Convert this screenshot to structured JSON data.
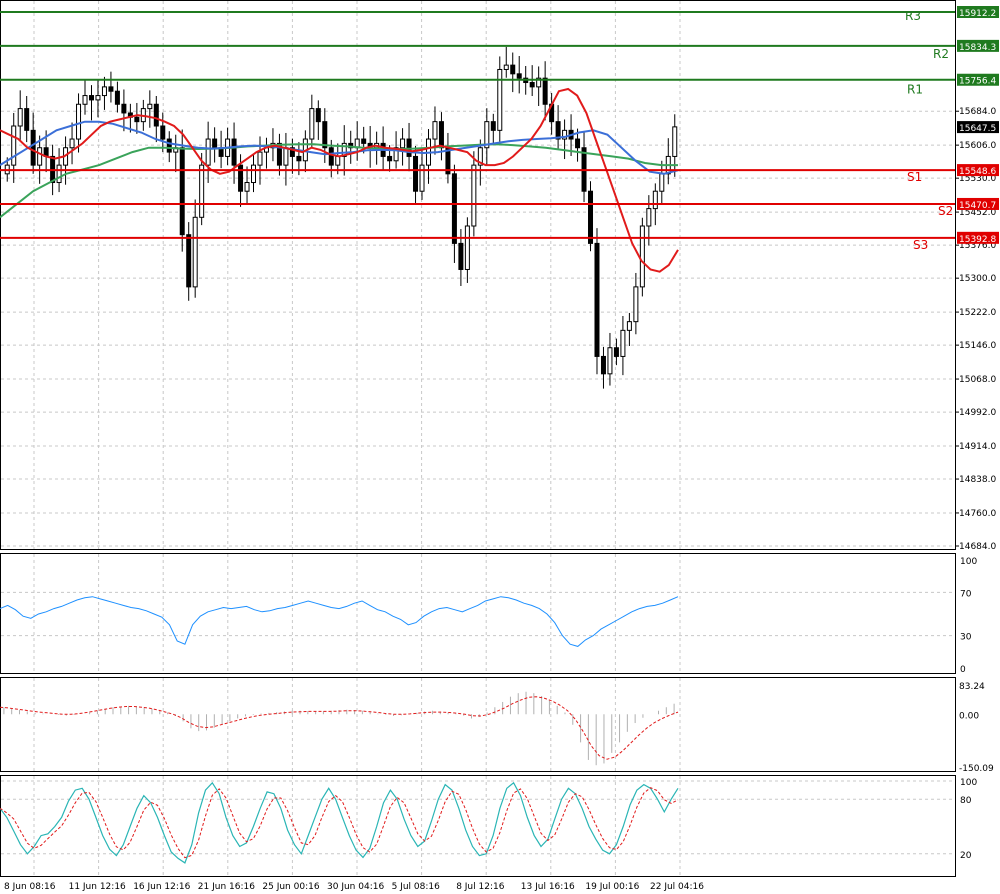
{
  "chart_data": [
    {
      "type": "candlestick",
      "y_ticks": [
        "15684.0",
        "15606.0",
        "15530.0",
        "15452.0",
        "15376.0",
        "15300.0",
        "15222.0",
        "15146.0",
        "15068.0",
        "14992.0",
        "14914.0",
        "14838.0",
        "14760.0",
        "14684.0"
      ],
      "ylim": [
        14684,
        15930
      ],
      "x_tick_labels": [
        "8 Jun 08:16",
        "11 Jun 12:16",
        "16 Jun 12:16",
        "21 Jun 16:16",
        "25 Jun 00:16",
        "30 Jun 04:16",
        "5 Jul 08:16",
        "8 Jul 12:16",
        "13 Jul 16:16",
        "19 Jul 00:16",
        "22 Jul 04:16"
      ],
      "current_price": "15647.5",
      "levels": [
        {
          "name": "R3",
          "value": 15912.2,
          "label": "15912.2",
          "color": "#1f7a1f"
        },
        {
          "name": "R2",
          "value": 15834.3,
          "label": "15834.3",
          "color": "#1f7a1f"
        },
        {
          "name": "R1",
          "value": 15756.4,
          "label": "15756.4",
          "color": "#1f7a1f"
        },
        {
          "name": "S1",
          "value": 15548.6,
          "label": "15548.6",
          "color": "#e00000"
        },
        {
          "name": "S2",
          "value": 15470.7,
          "label": "15470.7",
          "color": "#e00000"
        },
        {
          "name": "S3",
          "value": 15392.8,
          "label": "15392.8",
          "color": "#e00000"
        }
      ],
      "close_series": [
        15560,
        15650,
        15690,
        15640,
        15560,
        15600,
        15580,
        15520,
        15560,
        15600,
        15620,
        15700,
        15720,
        15710,
        15720,
        15740,
        15730,
        15700,
        15680,
        15670,
        15660,
        15690,
        15700,
        15650,
        15620,
        15590,
        15600,
        15400,
        15280,
        15440,
        15560,
        15620,
        15600,
        15580,
        15620,
        15560,
        15500,
        15520,
        15560,
        15590,
        15600,
        15610,
        15560,
        15600,
        15580,
        15570,
        15620,
        15690,
        15660,
        15600,
        15560,
        15580,
        15610,
        15600,
        15620,
        15610,
        15600,
        15610,
        15580,
        15570,
        15600,
        15620,
        15580,
        15500,
        15560,
        15620,
        15660,
        15600,
        15540,
        15380,
        15320,
        15420,
        15560,
        15600,
        15660,
        15640,
        15780,
        15790,
        15770,
        15760,
        15750,
        15740,
        15760,
        15700,
        15660,
        15620,
        15640,
        15620,
        15600,
        15500,
        15380,
        15120,
        15080,
        15140,
        15120,
        15180,
        15200,
        15280,
        15420,
        15460,
        15500,
        15540,
        15580,
        15648
      ],
      "ma_red": [
        15640,
        15630,
        15620,
        15600,
        15590,
        15580,
        15575,
        15580,
        15595,
        15610,
        15630,
        15650,
        15660,
        15665,
        15670,
        15675,
        15672,
        15668,
        15660,
        15650,
        15630,
        15600,
        15570,
        15550,
        15540,
        15545,
        15560,
        15575,
        15590,
        15600,
        15605,
        15600,
        15595,
        15590,
        15600,
        15595,
        15585,
        15580,
        15585,
        15590,
        15600,
        15605,
        15600,
        15598,
        15595,
        15592,
        15595,
        15600,
        15605,
        15600,
        15595,
        15590,
        15570,
        15560,
        15560,
        15565,
        15580,
        15600,
        15620,
        15650,
        15690,
        15730,
        15735,
        15720,
        15680,
        15620,
        15560,
        15500,
        15440,
        15380,
        15340,
        15320,
        15315,
        15330,
        15365
      ],
      "ma_blue": [
        15560,
        15580,
        15600,
        15620,
        15640,
        15650,
        15660,
        15660,
        15655,
        15645,
        15635,
        15620,
        15610,
        15605,
        15600,
        15598,
        15600,
        15603,
        15605,
        15603,
        15600,
        15595,
        15590,
        15585,
        15588,
        15590,
        15594,
        15595,
        15594,
        15590,
        15588,
        15590,
        15595,
        15600,
        15605,
        15610,
        15615,
        15618,
        15620,
        15622,
        15625,
        15635,
        15640,
        15630,
        15600,
        15570,
        15545,
        15540,
        15548
      ],
      "ma_green": [
        15440,
        15470,
        15500,
        15520,
        15540,
        15550,
        15560,
        15575,
        15590,
        15600,
        15600,
        15598,
        15597,
        15598,
        15600,
        15603,
        15605,
        15607,
        15608,
        15608,
        15605,
        15603,
        15600,
        15598,
        15597,
        15598,
        15600,
        15603,
        15605,
        15607,
        15608,
        15606,
        15603,
        15600,
        15595,
        15590,
        15585,
        15580,
        15575,
        15565,
        15560,
        15560
      ],
      "title": "",
      "xlabel": "",
      "ylabel": ""
    },
    {
      "type": "line",
      "name": "rsi_panel",
      "y_ticks": [
        "100",
        "70",
        "30",
        "0"
      ],
      "ylim": [
        0,
        100
      ],
      "values": [
        55,
        58,
        54,
        48,
        46,
        50,
        52,
        55,
        57,
        60,
        63,
        65,
        66,
        64,
        62,
        60,
        58,
        56,
        55,
        53,
        50,
        47,
        40,
        25,
        22,
        40,
        48,
        52,
        54,
        56,
        55,
        56,
        57,
        54,
        52,
        53,
        55,
        56,
        58,
        60,
        62,
        60,
        58,
        56,
        55,
        57,
        60,
        62,
        58,
        54,
        52,
        48,
        45,
        40,
        42,
        48,
        52,
        55,
        56,
        54,
        52,
        55,
        58,
        62,
        64,
        66,
        65,
        63,
        60,
        58,
        55,
        50,
        42,
        30,
        22,
        20,
        26,
        30,
        36,
        40,
        44,
        48,
        52,
        55,
        57,
        58,
        60,
        63,
        66
      ]
    },
    {
      "type": "bar",
      "name": "macd_panel",
      "y_ticks": [
        "83.24",
        "0.00",
        "-150.09"
      ],
      "ylim": [
        -150.09,
        83.24
      ],
      "histogram": [
        20,
        16,
        12,
        8,
        4,
        2,
        0,
        -2,
        -4,
        -2,
        0,
        5,
        10,
        16,
        20,
        22,
        24,
        22,
        20,
        16,
        10,
        5,
        -5,
        -20,
        -40,
        -48,
        -46,
        -38,
        -30,
        -20,
        -12,
        -6,
        -2,
        2,
        4,
        6,
        8,
        10,
        10,
        9,
        8,
        9,
        10,
        12,
        13,
        12,
        10,
        6,
        2,
        -2,
        -5,
        -3,
        0,
        4,
        8,
        10,
        8,
        5,
        2,
        -4,
        -12,
        -8,
        5,
        20,
        35,
        50,
        60,
        64,
        60,
        52,
        40,
        24,
        5,
        -30,
        -80,
        -130,
        -145,
        -140,
        -110,
        -80,
        -50,
        -25,
        -10,
        0,
        10,
        20,
        30
      ],
      "signal": [
        20,
        18,
        15,
        12,
        9,
        6,
        4,
        2,
        0,
        0,
        2,
        5,
        9,
        13,
        17,
        20,
        22,
        22,
        20,
        17,
        12,
        6,
        0,
        -10,
        -24,
        -34,
        -38,
        -36,
        -30,
        -24,
        -18,
        -12,
        -7,
        -3,
        0,
        2,
        4,
        6,
        7,
        8,
        8,
        8,
        8,
        9,
        10,
        10,
        9,
        7,
        5,
        2,
        0,
        0,
        1,
        3,
        5,
        6,
        6,
        5,
        3,
        0,
        -4,
        -5,
        0,
        8,
        18,
        30,
        40,
        48,
        50,
        46,
        38,
        26,
        10,
        -15,
        -50,
        -90,
        -118,
        -128,
        -122,
        -104,
        -82,
        -60,
        -40,
        -24,
        -12,
        -2,
        6
      ]
    },
    {
      "type": "line",
      "name": "stochastic_panel",
      "y_ticks": [
        "100",
        "80",
        "20"
      ],
      "ylim": [
        0,
        100
      ],
      "k_values": [
        70,
        60,
        45,
        30,
        20,
        28,
        40,
        42,
        50,
        60,
        78,
        90,
        92,
        80,
        60,
        40,
        25,
        18,
        30,
        50,
        70,
        84,
        76,
        60,
        40,
        22,
        15,
        10,
        30,
        65,
        90,
        98,
        86,
        60,
        40,
        28,
        32,
        50,
        70,
        88,
        86,
        70,
        46,
        30,
        20,
        40,
        60,
        80,
        92,
        80,
        60,
        40,
        24,
        16,
        26,
        50,
        76,
        90,
        80,
        58,
        40,
        28,
        34,
        56,
        80,
        96,
        90,
        70,
        46,
        28,
        18,
        20,
        40,
        70,
        92,
        98,
        84,
        60,
        40,
        28,
        36,
        58,
        80,
        92,
        86,
        70,
        50,
        36,
        24,
        20,
        30,
        50,
        74,
        90,
        96,
        92,
        80,
        66,
        80,
        92
      ]
    }
  ]
}
